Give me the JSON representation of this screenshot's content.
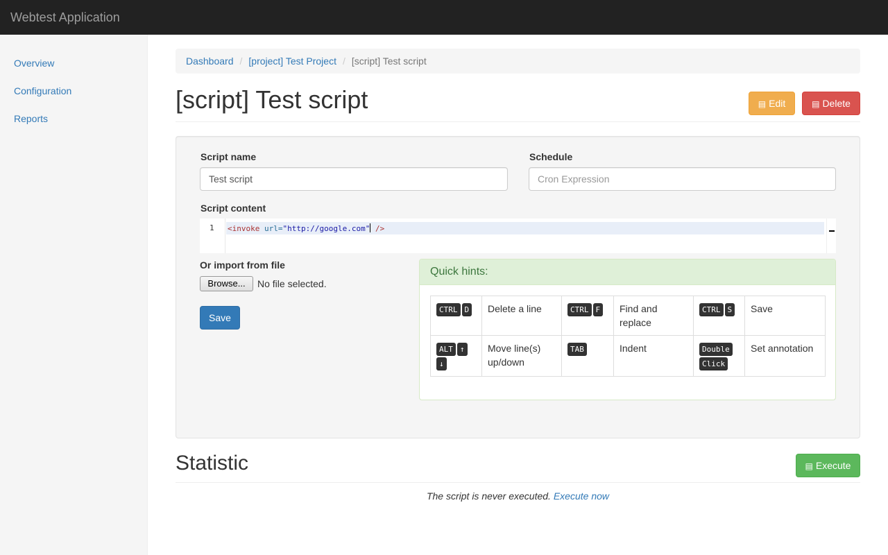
{
  "app": {
    "brand": "Webtest Application"
  },
  "sidebar": {
    "items": [
      {
        "label": "Overview"
      },
      {
        "label": "Configuration"
      },
      {
        "label": "Reports"
      }
    ]
  },
  "breadcrumb": {
    "items": [
      "Dashboard",
      "[project] Test Project"
    ],
    "active": "[script] Test script"
  },
  "page": {
    "title": "[script] Test script",
    "edit_label": "Edit",
    "delete_label": "Delete"
  },
  "form": {
    "script_name_label": "Script name",
    "script_name_value": "Test script",
    "schedule_label": "Schedule",
    "schedule_placeholder": "Cron Expression",
    "script_content_label": "Script content",
    "editor": {
      "line_number": "1",
      "code_tag_open": "<invoke",
      "code_attr": " url=",
      "code_string": "\"http://google.com\"",
      "code_tag_close": " />"
    },
    "import_label": "Or import from file",
    "browse_label": "Browse...",
    "file_status": "No file selected.",
    "save_label": "Save"
  },
  "hints": {
    "title": "Quick hints:",
    "rows": [
      [
        {
          "keys": [
            "CTRL",
            "D"
          ],
          "desc": "Delete a line"
        },
        {
          "keys": [
            "CTRL",
            "F"
          ],
          "desc": "Find and replace"
        },
        {
          "keys": [
            "CTRL",
            "S"
          ],
          "desc": "Save"
        }
      ],
      [
        {
          "keys": [
            "ALT",
            "↑",
            "↓"
          ],
          "desc": "Move line(s) up/down"
        },
        {
          "keys": [
            "TAB"
          ],
          "desc": "Indent"
        },
        {
          "keys": [
            "Double",
            "Click"
          ],
          "desc": "Set annotation"
        }
      ]
    ]
  },
  "statistic": {
    "title": "Statistic",
    "execute_label": "Execute",
    "message": "The script is never executed.",
    "execute_now_label": "Execute now"
  },
  "colors": {
    "primary": "#337ab7",
    "warning": "#f0ad4e",
    "danger": "#d9534f",
    "success": "#5cb85c",
    "navbar": "#222222"
  },
  "icons": {
    "edit": "edit-icon",
    "delete": "trash-icon",
    "execute": "play-icon"
  }
}
